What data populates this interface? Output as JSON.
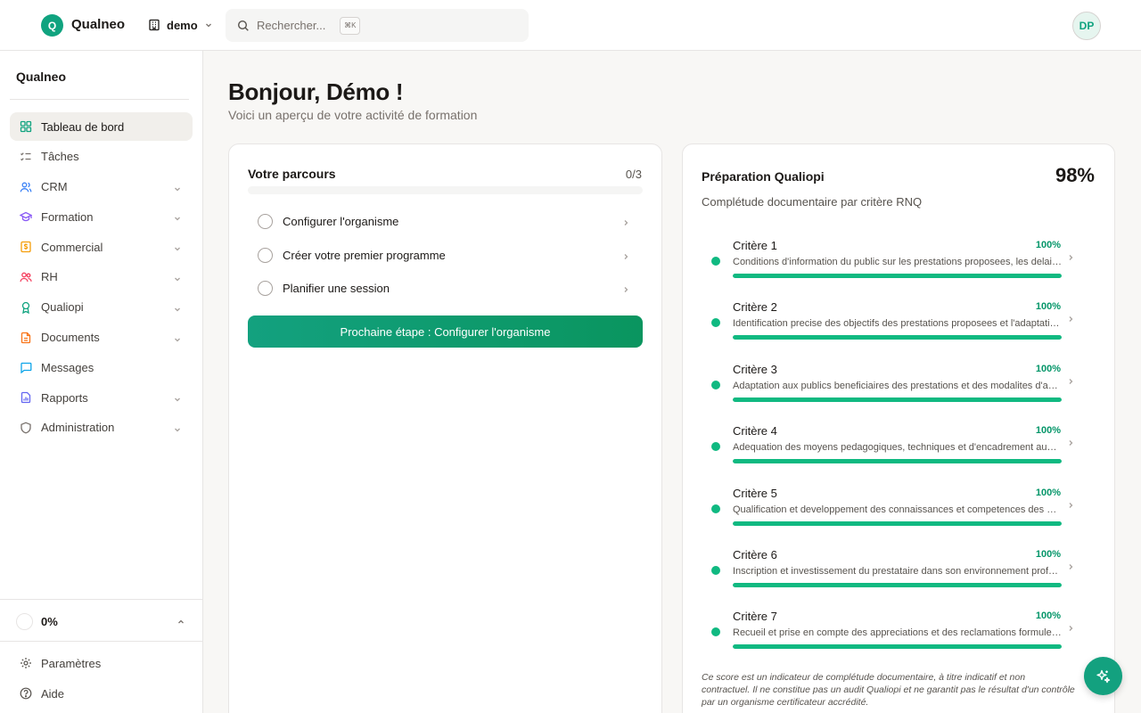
{
  "topbar": {
    "logo_letter": "Q",
    "brand": "Qualneo",
    "workspace": "demo",
    "search_placeholder": "Rechercher...",
    "shortcut": "⌘K",
    "avatar_initials": "DP"
  },
  "sidebar": {
    "brand": "Qualneo",
    "items": [
      {
        "label": "Tableau de bord",
        "icon": "grid-icon",
        "color": "#10a37f",
        "active": true,
        "expandable": false
      },
      {
        "label": "Tâches",
        "icon": "list-checks-icon",
        "color": "#78716c",
        "active": false,
        "expandable": false
      },
      {
        "label": "CRM",
        "icon": "users-icon",
        "color": "#3b82f6",
        "active": false,
        "expandable": true
      },
      {
        "label": "Formation",
        "icon": "graduation-cap-icon",
        "color": "#8b5cf6",
        "active": false,
        "expandable": true
      },
      {
        "label": "Commercial",
        "icon": "dollar-icon",
        "color": "#f59e0b",
        "active": false,
        "expandable": true
      },
      {
        "label": "RH",
        "icon": "people-icon",
        "color": "#f43f5e",
        "active": false,
        "expandable": true
      },
      {
        "label": "Qualiopi",
        "icon": "award-icon",
        "color": "#10a37f",
        "active": false,
        "expandable": true
      },
      {
        "label": "Documents",
        "icon": "file-icon",
        "color": "#f97316",
        "active": false,
        "expandable": true
      },
      {
        "label": "Messages",
        "icon": "message-icon",
        "color": "#0ea5e9",
        "active": false,
        "expandable": false
      },
      {
        "label": "Rapports",
        "icon": "report-icon",
        "color": "#6366f1",
        "active": false,
        "expandable": true
      },
      {
        "label": "Administration",
        "icon": "shield-icon",
        "color": "#78716c",
        "active": false,
        "expandable": true
      }
    ],
    "progress_value": "0%",
    "settings_label": "Paramètres",
    "help_label": "Aide"
  },
  "main": {
    "greeting": "Bonjour, Démo !",
    "subtitle": "Voici un aperçu de votre activité de formation"
  },
  "journey": {
    "title": "Votre parcours",
    "count": "0/3",
    "progress": 0,
    "steps": [
      {
        "label": "Configurer l'organisme"
      },
      {
        "label": "Créer votre premier programme"
      },
      {
        "label": "Planifier une session"
      }
    ],
    "cta": "Prochaine étape : Configurer l'organisme"
  },
  "qualiopi": {
    "title": "Préparation Qualiopi",
    "percent": "98%",
    "subtitle": "Complétude documentaire par critère RNQ",
    "criteria": [
      {
        "name": "Critère 1",
        "percent": "100%",
        "progress": 1.0,
        "desc": "Conditions d'information du public sur les prestations proposees, les delais d'acces et les resultats obtenus"
      },
      {
        "name": "Critère 2",
        "percent": "100%",
        "progress": 1.0,
        "desc": "Identification precise des objectifs des prestations proposees et l'adaptation de ces prestations aux publics beneficiaires"
      },
      {
        "name": "Critère 3",
        "percent": "100%",
        "progress": 1.0,
        "desc": "Adaptation aux publics beneficiaires des prestations et des modalites d'accueil, d'accompagnement, de suivi et d'evaluation"
      },
      {
        "name": "Critère 4",
        "percent": "100%",
        "progress": 1.0,
        "desc": "Adequation des moyens pedagogiques, techniques et d'encadrement aux prestations mises en oeuvre"
      },
      {
        "name": "Critère 5",
        "percent": "100%",
        "progress": 1.0,
        "desc": "Qualification et developpement des connaissances et competences des personnels charges de mettre en oeuvre les prestations"
      },
      {
        "name": "Critère 6",
        "percent": "100%",
        "progress": 1.0,
        "desc": "Inscription et investissement du prestataire dans son environnement professionnel"
      },
      {
        "name": "Critère 7",
        "percent": "100%",
        "progress": 1.0,
        "desc": "Recueil et prise en compte des appreciations et des reclamations formulees par les parties prenantes"
      }
    ],
    "disclaimer": "Ce score est un indicateur de complétude documentaire, à titre indicatif et non contractuel. Il ne constitue pas un audit Qualiopi et ne garantit pas le résultat d'un contrôle par un organisme certificateur accrédité."
  },
  "colors": {
    "accent": "#10a37f",
    "success": "#10b981"
  }
}
